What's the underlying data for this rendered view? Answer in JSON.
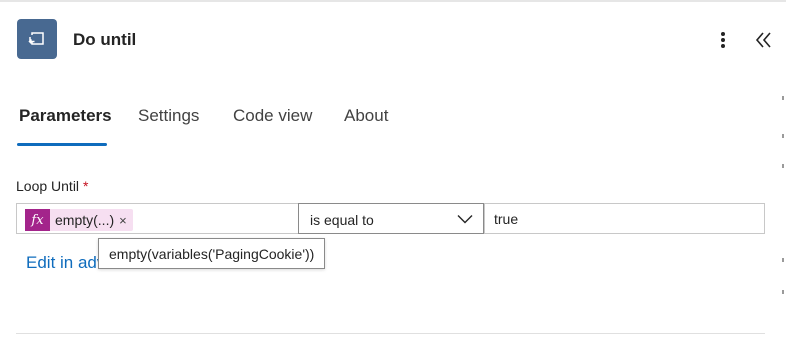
{
  "header": {
    "title": "Do until",
    "icon": "loop-icon",
    "more_icon": "more-vertical-icon",
    "collapse_icon": "chevron-double-left-icon"
  },
  "tabs": [
    {
      "label": "Parameters",
      "active": true
    },
    {
      "label": "Settings",
      "active": false
    },
    {
      "label": "Code view",
      "active": false
    },
    {
      "label": "About",
      "active": false
    }
  ],
  "loop_until": {
    "label": "Loop Until",
    "required_marker": "*",
    "left_token": {
      "fx_icon": "fx",
      "label": "empty(...)",
      "remove_glyph": "×"
    },
    "operator": "is equal to",
    "right_value": "true",
    "edit_link": "Edit in advanced mode",
    "tooltip": "empty(variables('PagingCookie'))"
  },
  "colors": {
    "accent": "#0f6cbd",
    "icon_bg": "#486991",
    "token_fx_bg": "#a3248b",
    "token_bg": "#f6dff1",
    "required": "#c50f1f"
  }
}
